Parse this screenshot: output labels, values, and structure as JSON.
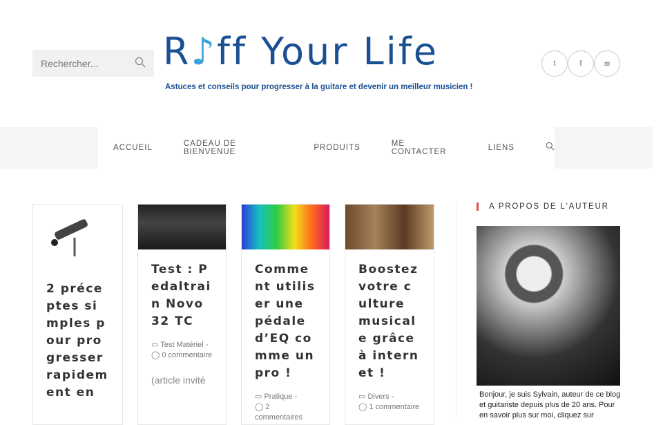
{
  "header": {
    "search_placeholder": "Rechercher...",
    "logo_text_pre": "R",
    "logo_text_post": "ff Your Life",
    "tagline": "Astuces et conseils pour progresser à la guitare et devenir un meilleur musicien !",
    "social": [
      {
        "icon": "twitter-icon",
        "glyph": "t"
      },
      {
        "icon": "facebook-icon",
        "glyph": "f"
      },
      {
        "icon": "rss-icon",
        "glyph": "≋"
      }
    ]
  },
  "nav": {
    "items": [
      "ACCUEIL",
      "CADEAU DE BIENVENUE",
      "PRODUITS",
      "ME CONTACTER",
      "LIENS"
    ]
  },
  "posts": [
    {
      "title": "2 préceptes simples pour progresser rapidement en",
      "category": "",
      "comments": "",
      "excerpt": ""
    },
    {
      "title": "Test : Pedaltrain Novo 32 TC",
      "category": "Test Matériel",
      "comments": "0 commentaire",
      "excerpt": "(article invité"
    },
    {
      "title": "Comment utiliser une pédale d’EQ comme un pro !",
      "category": "Pratique",
      "comments": "2 commentaires",
      "excerpt": ""
    },
    {
      "title": "Boostez votre culture musicale grâce à internet !",
      "category": "Divers",
      "comments": "1 commentaire",
      "excerpt": ""
    }
  ],
  "sidebar": {
    "heading": "A PROPOS DE L'AUTEUR",
    "bio": "Bonjour, je suis Sylvain, auteur de ce blog et guitariste depuis plus de 20 ans. Pour en savoir plus sur moi, cliquez sur"
  },
  "colors": {
    "brand": "#1a4f93",
    "accent": "#d9534f"
  }
}
